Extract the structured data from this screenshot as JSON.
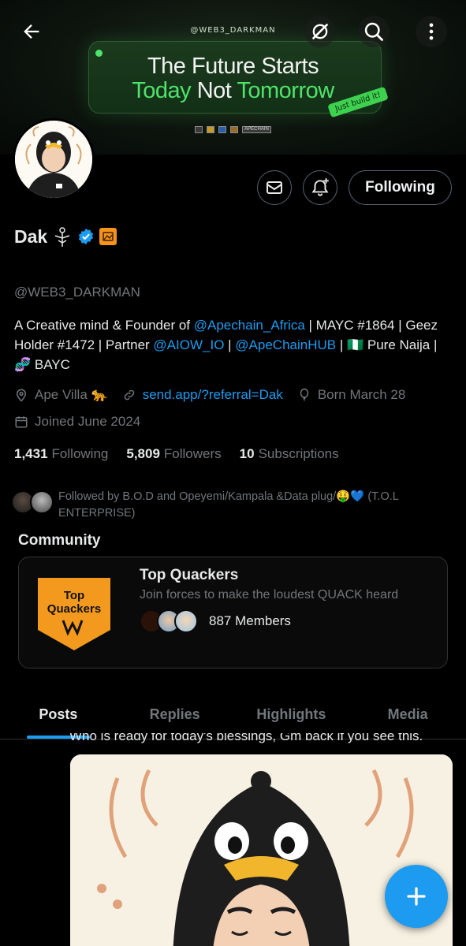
{
  "header": {
    "banner_handle": "@WEB3_DARKMAN",
    "banner_line1": "The Future Starts",
    "banner_line2_a": "Today",
    "banner_line2_b": " Not ",
    "banner_line2_c": "Tomorrow",
    "banner_tag": "Just build it!",
    "banner_logo_text": "APECHAIN",
    "icons": [
      "back-arrow-icon",
      "grok-icon",
      "search-icon",
      "more-vertical-icon"
    ]
  },
  "profile": {
    "name": "Dak",
    "handle": "@WEB3_DARKMAN",
    "bio_parts": {
      "p1": "A Creative mind & Founder of ",
      "link1": "@Apechain_Africa",
      "p2": " | MAYC #1864 | Geez Holder #1472 | Partner ",
      "link2": "@AIOW_IO",
      "p3": " | ",
      "link3": "@ApeChainHUB",
      "p4": " | 🇳🇬 Pure Naija | 🧬 BAYC"
    },
    "location": "Ape Villa 🐆",
    "website": "send.app/?referral=Dak",
    "birthday": "Born March 28",
    "joined": "Joined June 2024",
    "following_count": "1,431",
    "following_label": "Following",
    "followers_count": "5,809",
    "followers_label": "Followers",
    "subscriptions_count": "10",
    "subscriptions_label": "Subscriptions",
    "followed_by": "Followed by B.O.D and Opeyemi/Kampala &Data plug/🤑💙 (T.O.L ENTERPRISE)"
  },
  "actions": {
    "following_button": "Following"
  },
  "community": {
    "section_label": "Community",
    "name": "Top Quackers",
    "description": "Join forces to make the loudest QUACK heard",
    "members": "887 Members",
    "image_text_line1": "Top",
    "image_text_line2": "Quackers"
  },
  "tabs": [
    {
      "label": "Posts",
      "active": true
    },
    {
      "label": "Replies",
      "active": false
    },
    {
      "label": "Highlights",
      "active": false
    },
    {
      "label": "Media",
      "active": false
    }
  ],
  "post": {
    "text": "Who is ready for today's blessings, Gm back if you see this."
  },
  "colors": {
    "accent": "#1d9bf0",
    "banner_green": "#4fe36a",
    "muted": "#71767b",
    "community_orange": "#f39a1e"
  }
}
